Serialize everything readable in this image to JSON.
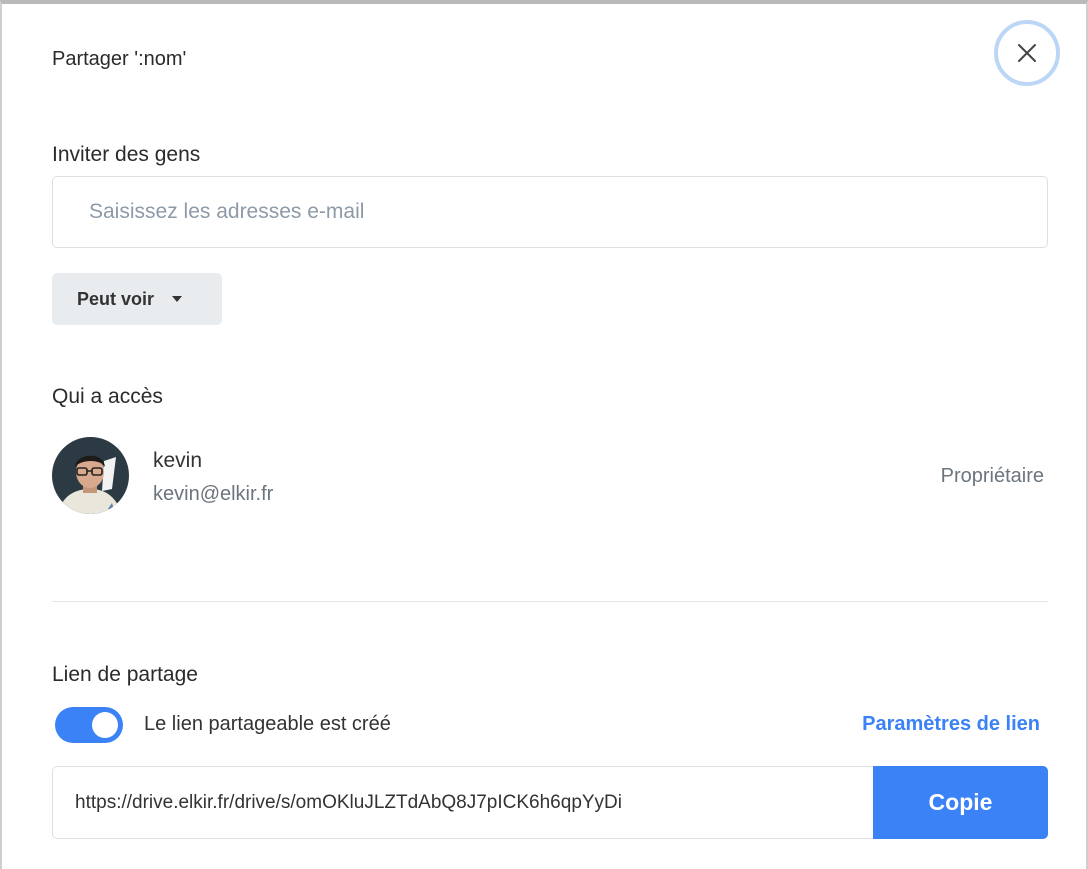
{
  "dialog": {
    "title": "Partager ':nom'",
    "close_icon": "close-icon"
  },
  "invite": {
    "label": "Inviter des gens",
    "email_value": "",
    "email_placeholder": "Saisissez les adresses e-mail",
    "permission_label": "Peut voir",
    "permission_icon": "caret-down-icon"
  },
  "access": {
    "label": "Qui a accès",
    "users": [
      {
        "name": "kevin",
        "email": "kevin@elkir.fr",
        "role": "Propriétaire",
        "avatar_icon": "user-avatar"
      }
    ]
  },
  "share_link": {
    "label": "Lien de partage",
    "toggle_on": true,
    "toggle_label": "Le lien partageable est créé",
    "settings_label": "Paramètres de lien",
    "url": "https://drive.elkir.fr/drive/s/omOKluJLZTdAbQ8J7pICK6h6qpYyDi",
    "copy_label": "Copie"
  },
  "colors": {
    "accent": "#3b82f6",
    "close_focus_ring": "#bcd7f5",
    "button_gray": "#e9ecef",
    "muted_text": "#6c757d"
  }
}
